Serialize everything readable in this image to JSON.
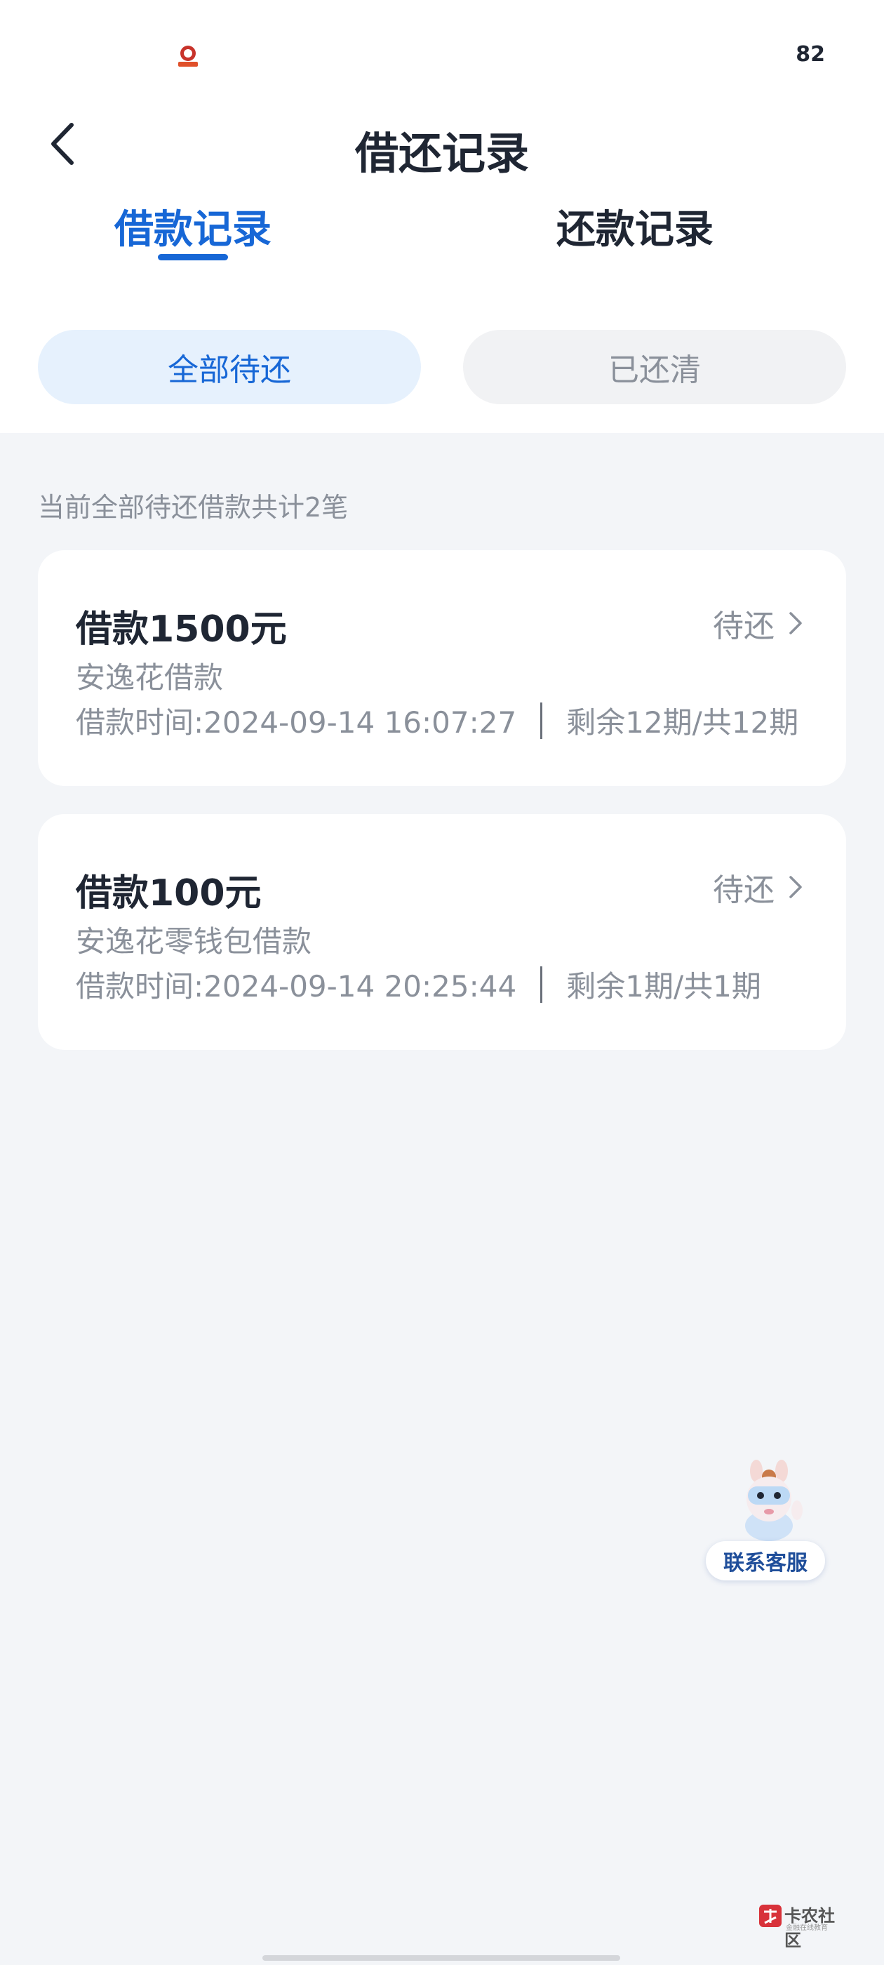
{
  "status_bar": {
    "battery": "82"
  },
  "nav": {
    "title": "借还记录"
  },
  "tabs": [
    {
      "label": "借款记录",
      "active": true
    },
    {
      "label": "还款记录",
      "active": false
    }
  ],
  "filters": [
    {
      "label": "全部待还",
      "active": true
    },
    {
      "label": "已还清",
      "active": false
    }
  ],
  "summary": "当前全部待还借款共计2笔",
  "loans": [
    {
      "amount": "借款1500元",
      "status": "待还",
      "product": "安逸花借款",
      "time": "借款时间:2024-09-14 16:07:27",
      "periods": "剩余12期/共12期"
    },
    {
      "amount": "借款100元",
      "status": "待还",
      "product": "安逸花零钱包借款",
      "time": "借款时间:2024-09-14 20:25:44",
      "periods": "剩余1期/共1期"
    }
  ],
  "service": {
    "label": "联系客服"
  },
  "watermark": {
    "text": "卡农社区",
    "sub": "金融在线教育"
  },
  "colors": {
    "accent": "#1767d6",
    "background": "#f3f5f8",
    "muted": "#8a909a"
  }
}
